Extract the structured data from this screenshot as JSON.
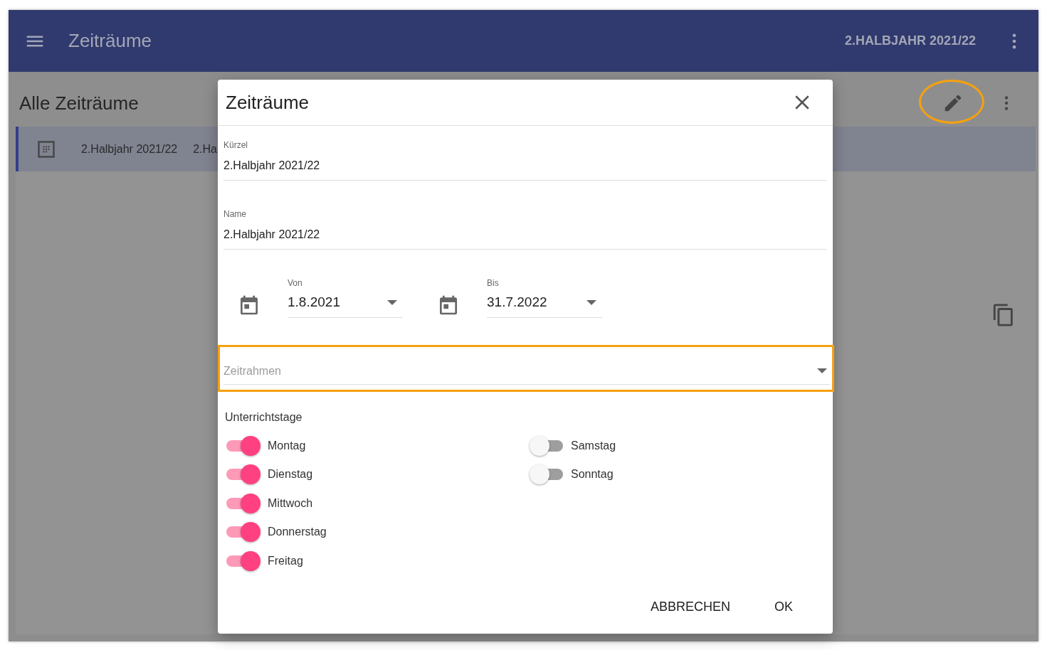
{
  "app_bar": {
    "title": "Zeiträume",
    "period": "2.HALBJAHR 2021/22"
  },
  "list_panel": {
    "title": "Alle Zeiträume",
    "edit_highlighted": true,
    "rows": [
      {
        "cells": [
          "2.Halbjahr 2021/22",
          "2.Ha"
        ],
        "selected": true
      }
    ]
  },
  "dialog": {
    "title": "Zeiträume",
    "fields": [
      {
        "label": "Kürzel",
        "value": "2.Halbjahr 2021/22"
      },
      {
        "label": "Name",
        "value": "2.Halbjahr 2021/22"
      }
    ],
    "dates": [
      {
        "label": "Von",
        "value": "1.8.2021"
      },
      {
        "label": "Bis",
        "value": "31.7.2022"
      }
    ],
    "timeframe": {
      "placeholder": "Zeitrahmen",
      "highlighted": true
    },
    "days_title": "Unterrichtstage",
    "days": [
      {
        "label": "Montag",
        "on": true
      },
      {
        "label": "Dienstag",
        "on": true
      },
      {
        "label": "Mittwoch",
        "on": true
      },
      {
        "label": "Donnerstag",
        "on": true
      },
      {
        "label": "Freitag",
        "on": true
      },
      {
        "label": "Samstag",
        "on": false
      },
      {
        "label": "Sonntag",
        "on": false
      }
    ],
    "buttons": [
      "ABBRECHEN",
      "OK"
    ]
  }
}
